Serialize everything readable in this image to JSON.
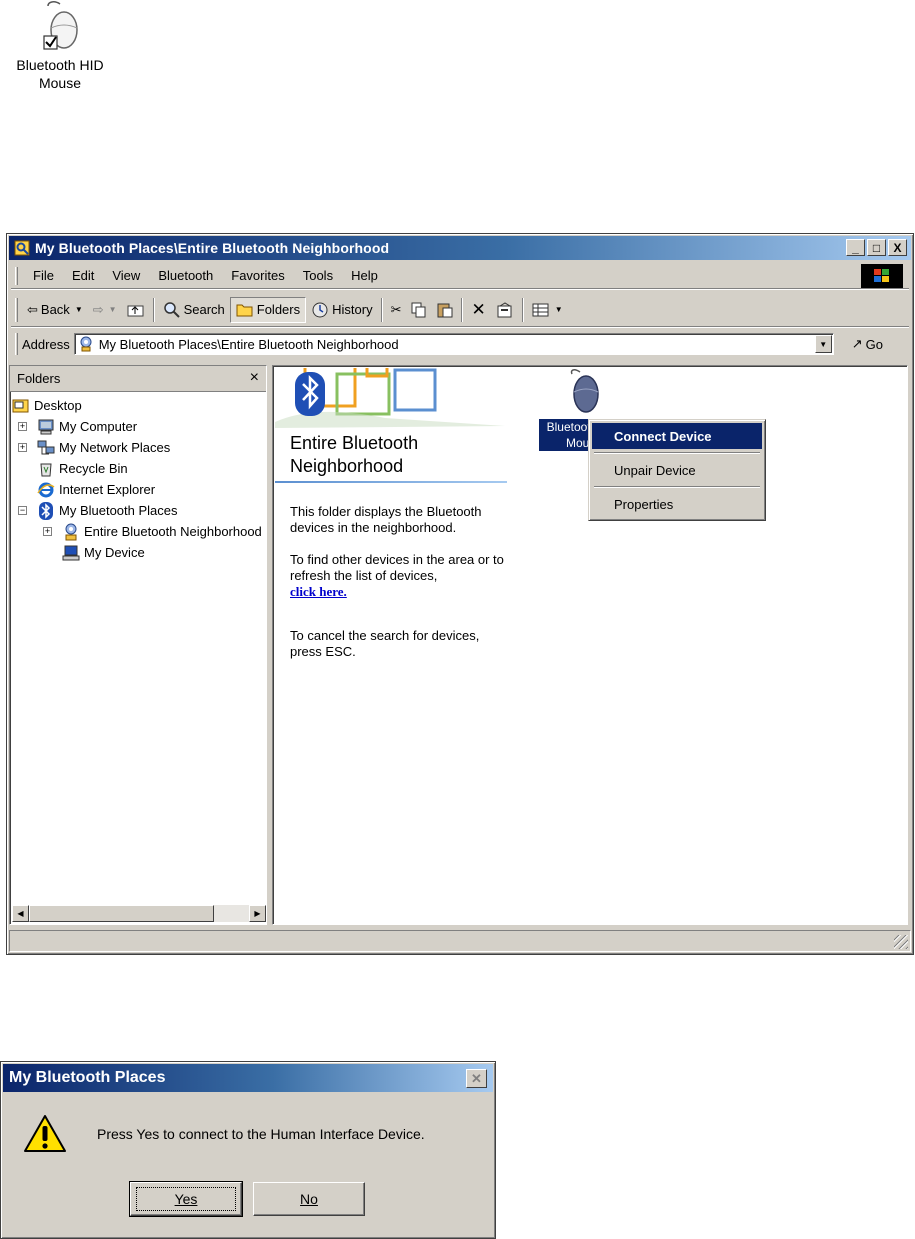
{
  "desktop_icon": {
    "label_line1": "Bluetooth HID",
    "label_line2": "Mouse"
  },
  "window": {
    "title": "My Bluetooth Places\\Entire Bluetooth Neighborhood",
    "title_buttons": [
      "_",
      "□",
      "X"
    ],
    "menu": [
      "File",
      "Edit",
      "View",
      "Bluetooth",
      "Favorites",
      "Tools",
      "Help"
    ],
    "toolbar": {
      "back": "Back",
      "search": "Search",
      "folders": "Folders",
      "history": "History"
    },
    "address": {
      "label": "Address",
      "value": "My Bluetooth Places\\Entire Bluetooth Neighborhood",
      "go": "Go"
    },
    "folders_pane": {
      "title": "Folders",
      "close": "×",
      "tree": [
        {
          "label": "Desktop",
          "icon": "desktop-icon",
          "expander": ""
        },
        {
          "label": "My Computer",
          "icon": "my-computer-icon",
          "expander": "+"
        },
        {
          "label": "My Network Places",
          "icon": "network-places-icon",
          "expander": "+"
        },
        {
          "label": "Recycle Bin",
          "icon": "recycle-bin-icon",
          "expander": ""
        },
        {
          "label": "Internet Explorer",
          "icon": "internet-explorer-icon",
          "expander": ""
        },
        {
          "label": "My Bluetooth Places",
          "icon": "bluetooth-icon",
          "expander": "−"
        },
        {
          "label": "Entire Bluetooth Neighborhood",
          "icon": "neighborhood-icon",
          "expander": "+"
        },
        {
          "label": "My Device",
          "icon": "my-device-icon",
          "expander": ""
        }
      ]
    },
    "content": {
      "folder_title_line1": "Entire Bluetooth",
      "folder_title_line2": "Neighborhood",
      "info_p1": "This folder displays the Bluetooth devices in the neighborhood.",
      "info_p2": "To find other devices in the area or to refresh the list of devices,",
      "info_link": "click here.",
      "info_p3": "To cancel the search for devices, press ESC.",
      "device_label_line1": "Bluetooth HID",
      "device_label_line2": "Mouse"
    },
    "context_menu": [
      "Connect Device",
      "Unpair Device",
      "Properties"
    ]
  },
  "dialog": {
    "title": "My Bluetooth Places",
    "message": "Press Yes to connect to the Human Interface Device.",
    "yes": "Yes",
    "no": "No"
  },
  "colors": {
    "titlebar": "#0a246a",
    "chrome": "#d4d0c8",
    "highlight": "#0a246a",
    "link": "#0000cc"
  }
}
